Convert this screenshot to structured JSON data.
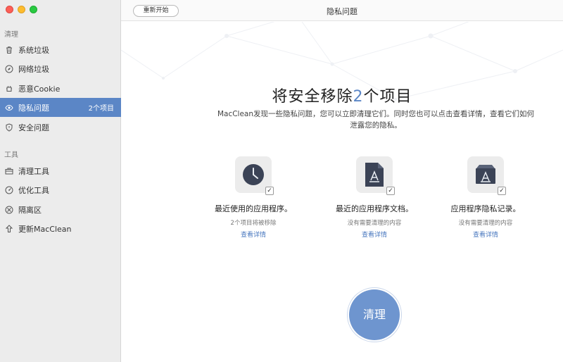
{
  "window": {
    "title": "隐私问题",
    "restart_label": "重新开始"
  },
  "sidebar": {
    "section_clean": "清理",
    "section_tools": "工具",
    "items": [
      {
        "label": "系统垃圾",
        "icon": "trash-icon"
      },
      {
        "label": "网络垃圾",
        "icon": "compass-icon"
      },
      {
        "label": "恶意Cookie",
        "icon": "cookie-icon"
      },
      {
        "label": "隐私问题",
        "icon": "eye-icon",
        "badge": "2个项目",
        "active": true
      },
      {
        "label": "安全问题",
        "icon": "shield-icon"
      }
    ],
    "tools": [
      {
        "label": "清理工具",
        "icon": "toolbox-icon"
      },
      {
        "label": "优化工具",
        "icon": "speedometer-icon"
      },
      {
        "label": "隔离区",
        "icon": "quarantine-icon"
      },
      {
        "label": "更新MacClean",
        "icon": "arrow-up-icon"
      }
    ]
  },
  "main": {
    "headline_prefix": "将安全移除",
    "headline_count": "2",
    "headline_suffix": "个项目",
    "description": "MacClean发现一些隐私问题，您可以立即清理它们。同时您也可以点击查看详情，查看它们如何泄露您的隐私。",
    "cards": [
      {
        "title": "最近使用的应用程序。",
        "sub": "2个项目将被移除",
        "link": "查看详情",
        "icon": "clock-icon",
        "checked": true
      },
      {
        "title": "最近的应用程序文档。",
        "sub": "没有需要清理的内容",
        "link": "查看详情",
        "icon": "document-icon",
        "checked": true
      },
      {
        "title": "应用程序隐私记录。",
        "sub": "没有需要清理的内容",
        "link": "查看详情",
        "icon": "app-store-icon",
        "checked": true
      }
    ],
    "clean_button": "清理",
    "check_glyph": "✓"
  },
  "colors": {
    "accent": "#5b86c6",
    "sidebar_bg": "#ececec",
    "button_fill": "#6e95cf"
  }
}
